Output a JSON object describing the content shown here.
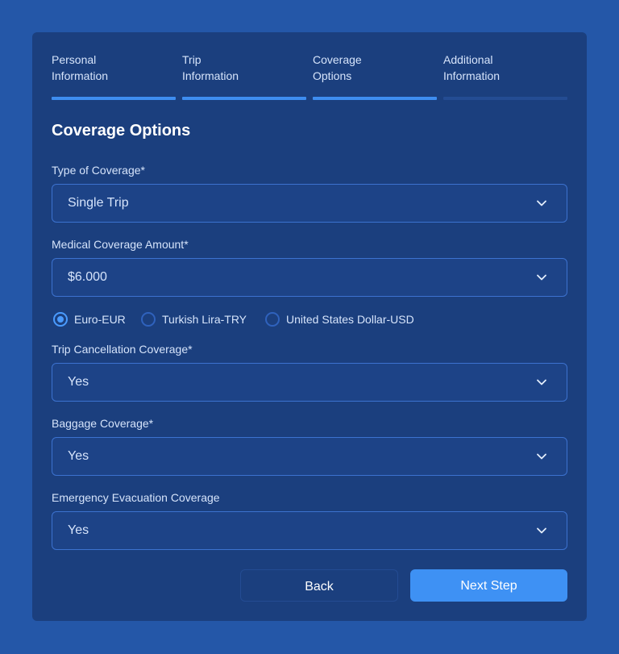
{
  "steps": [
    {
      "label": "Personal\nInformation",
      "active": true
    },
    {
      "label": "Trip\nInformation",
      "active": true
    },
    {
      "label": "Coverage\nOptions",
      "active": true
    },
    {
      "label": "Additional\nInformation",
      "active": false
    }
  ],
  "section_title": "Coverage Options",
  "fields": {
    "type_of_coverage": {
      "label": "Type of Coverage*",
      "value": "Single Trip"
    },
    "medical_coverage_amount": {
      "label": "Medical Coverage Amount*",
      "value": "$6.000"
    },
    "trip_cancellation": {
      "label": "Trip Cancellation Coverage*",
      "value": "Yes"
    },
    "baggage": {
      "label": "Baggage Coverage*",
      "value": "Yes"
    },
    "emergency_evacuation": {
      "label": "Emergency Evacuation Coverage",
      "value": "Yes"
    }
  },
  "currency_options": [
    {
      "label": "Euro-EUR",
      "checked": true
    },
    {
      "label": "Turkish Lira-TRY",
      "checked": false
    },
    {
      "label": "United States Dollar-USD",
      "checked": false
    }
  ],
  "buttons": {
    "back_label": "Back",
    "next_label": "Next Step"
  },
  "colors": {
    "background": "#2457a8",
    "card": "#1b3f7e",
    "accent": "#3e91f4",
    "inactive_bar": "#244c93"
  },
  "icons": {
    "dropdown": "chevron-down-icon"
  }
}
